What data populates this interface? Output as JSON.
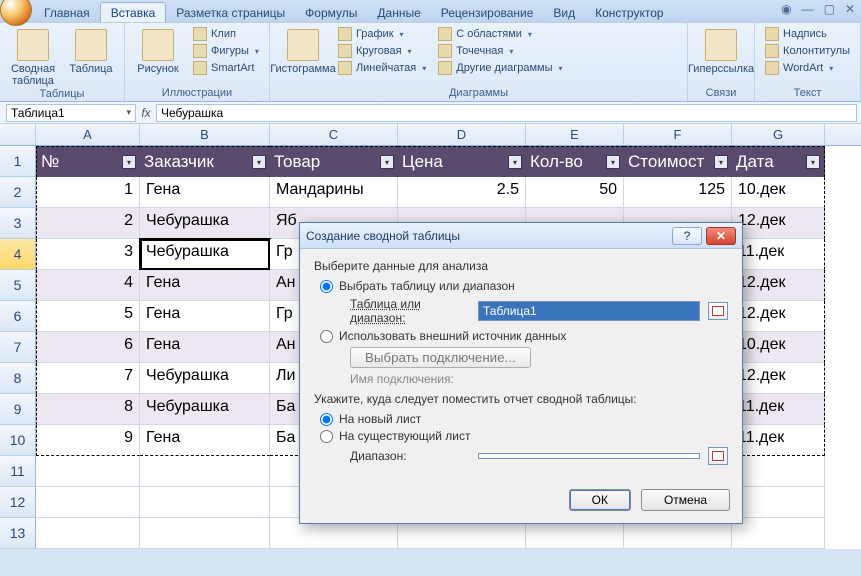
{
  "tabs": {
    "items": [
      "Главная",
      "Вставка",
      "Разметка страницы",
      "Формулы",
      "Данные",
      "Рецензирование",
      "Вид",
      "Конструктор"
    ],
    "active_index": 1
  },
  "ribbon": {
    "tables": {
      "label": "Таблицы",
      "pivot": "Сводная\nтаблица",
      "table": "Таблица"
    },
    "illus": {
      "label": "Иллюстрации",
      "picture": "Рисунок",
      "clip": "Клип",
      "shapes": "Фигуры",
      "smartart": "SmartArt"
    },
    "charts": {
      "label": "Диаграммы",
      "column": "Гистограмма",
      "line": "График",
      "pie": "Круговая",
      "bar": "Линейчатая",
      "area": "С областями",
      "scatter": "Точечная",
      "other": "Другие диаграммы"
    },
    "links": {
      "label": "Связи",
      "hyperlink": "Гиперссылка"
    },
    "text": {
      "label": "Текст",
      "textbox": "Надпись",
      "headerfooter": "Колонтитулы",
      "wordart": "WordArt"
    }
  },
  "namebox": "Таблица1",
  "formula": "Чебурашка",
  "columns": [
    "A",
    "B",
    "C",
    "D",
    "E",
    "F",
    "G"
  ],
  "table": {
    "headers": [
      "№",
      "Заказчик",
      "Товар",
      "Цена",
      "Кол-во",
      "Стоимост",
      "Дата"
    ],
    "rows": [
      {
        "n": "1",
        "cust": "Гена",
        "item": "Мандарины",
        "price": "2.5",
        "qty": "50",
        "cost": "125",
        "date": "10.дек"
      },
      {
        "n": "2",
        "cust": "Чебурашка",
        "item": "Яб",
        "price": "",
        "qty": "",
        "cost": "",
        "date": "12.дек"
      },
      {
        "n": "3",
        "cust": "Чебурашка",
        "item": "Гр",
        "price": "",
        "qty": "",
        "cost": "",
        "date": "11.дек"
      },
      {
        "n": "4",
        "cust": "Гена",
        "item": "Ан",
        "price": "",
        "qty": "",
        "cost": "",
        "date": "12.дек"
      },
      {
        "n": "5",
        "cust": "Гена",
        "item": "Гр",
        "price": "",
        "qty": "",
        "cost": "",
        "date": "12.дек"
      },
      {
        "n": "6",
        "cust": "Гена",
        "item": "Ан",
        "price": "",
        "qty": "",
        "cost": "",
        "date": "10.дек"
      },
      {
        "n": "7",
        "cust": "Чебурашка",
        "item": "Ли",
        "price": "",
        "qty": "",
        "cost": "",
        "date": "12.дек"
      },
      {
        "n": "8",
        "cust": "Чебурашка",
        "item": "Ба",
        "price": "",
        "qty": "",
        "cost": "",
        "date": "11.дек"
      },
      {
        "n": "9",
        "cust": "Гена",
        "item": "Ба",
        "price": "",
        "qty": "",
        "cost": "",
        "date": "11.дек"
      }
    ]
  },
  "dialog": {
    "title": "Создание сводной таблицы",
    "section1": "Выберите данные для анализа",
    "opt_select": "Выбрать таблицу или диапазон",
    "range_label": "Таблица или диапазон:",
    "range_value": "Таблица1",
    "opt_external": "Использовать внешний источник данных",
    "choose_conn": "Выбрать подключение...",
    "conn_name": "Имя подключения:",
    "section2": "Укажите, куда следует поместить отчет сводной таблицы:",
    "opt_newsheet": "На новый лист",
    "opt_existing": "На существующий лист",
    "range2_label": "Диапазон:",
    "ok": "ОК",
    "cancel": "Отмена"
  }
}
